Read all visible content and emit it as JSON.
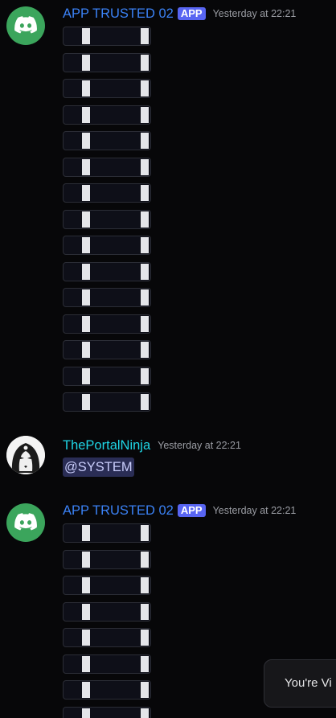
{
  "messages": [
    {
      "author": "APP TRUSTED 02",
      "badge": "APP",
      "timestamp": "Yesterday at 22:21",
      "avatar_icon": "discord-logo-icon",
      "avatar_color": "#3ba55c",
      "name_color": "#3b82f6",
      "button_count": 15
    },
    {
      "author": "ThePortalNinja",
      "timestamp": "Yesterday at 22:21",
      "avatar_icon": "ninja-avatar-icon",
      "name_color": "#1fd6e6",
      "mention": "@SYSTEM"
    },
    {
      "author": "APP TRUSTED 02",
      "badge": "APP",
      "timestamp": "Yesterday at 22:21",
      "avatar_icon": "discord-logo-icon",
      "avatar_color": "#3ba55c",
      "name_color": "#3b82f6",
      "button_count_visible": 8
    }
  ],
  "toast": {
    "text": "You're Vi"
  },
  "colors": {
    "background": "#070709",
    "app_badge": "#5865f2",
    "mention_bg": "#2a2d55",
    "button_bg": "#0e0f18"
  }
}
